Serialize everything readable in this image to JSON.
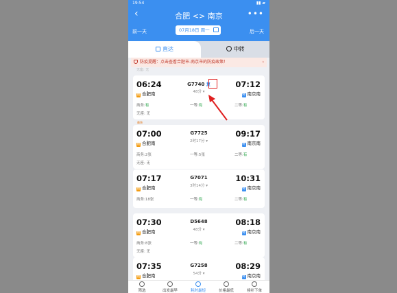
{
  "status_bar": {
    "time": "19:54",
    "icons": "▮▮ ▰"
  },
  "header": {
    "back": "‹",
    "title": "合肥 <> 南京",
    "more": "•••",
    "prev_day": "前一天",
    "next_day": "后一天",
    "date": "07月18日 周一"
  },
  "tabs": {
    "direct": "直达",
    "transfer": "中转"
  },
  "notice": {
    "text": "防疫提醒：点击查看合肥市-南京市的防疫政策！",
    "arrow": "›"
  },
  "cutoff_text": "无座: 无",
  "trains": [
    {
      "dep_time": "06:24",
      "arr_time": "07:12",
      "train_no": "G7740",
      "tag_icon": "复",
      "duration": "48分",
      "dep_station": "合肥南",
      "arr_station": "南京南",
      "dep_badge": "始",
      "arr_badge": "终",
      "seats": [
        {
          "label": "商务:",
          "value": "有"
        },
        {
          "label": "一等:",
          "value": "有"
        },
        {
          "label": "二等:",
          "value": "有"
        }
      ],
      "noseat": "无座: 无",
      "tag": ""
    },
    {
      "dep_time": "07:00",
      "arr_time": "09:17",
      "train_no": "G7725",
      "duration": "2时17分",
      "dep_station": "合肥南",
      "arr_station": "南京南",
      "dep_badge": "始",
      "arr_badge": "终",
      "seats": [
        {
          "label": "商务:",
          "value": "2张"
        },
        {
          "label": "一等:",
          "value": "5张"
        },
        {
          "label": "二等:",
          "value": "有"
        }
      ],
      "noseat": "无座: 无",
      "tag": "最快"
    },
    {
      "dep_time": "07:17",
      "arr_time": "10:31",
      "train_no": "G7071",
      "duration": "3时14分",
      "dep_station": "合肥南",
      "arr_station": "南京南",
      "dep_badge": "始",
      "arr_badge": "终",
      "seats": [
        {
          "label": "商务:",
          "value": "18张"
        },
        {
          "label": "一等:",
          "value": "有"
        },
        {
          "label": "二等:",
          "value": "有"
        }
      ],
      "noseat": "",
      "tag": ""
    },
    {
      "dep_time": "07:30",
      "arr_time": "08:18",
      "train_no": "D5648",
      "duration": "48分",
      "dep_station": "合肥南",
      "arr_station": "南京南",
      "dep_badge": "始",
      "arr_badge": "终",
      "seats": [
        {
          "label": "商务:",
          "value": "8张"
        },
        {
          "label": "一等:",
          "value": "有"
        },
        {
          "label": "二等:",
          "value": "有"
        }
      ],
      "noseat": "无座: 无",
      "tag": ""
    },
    {
      "dep_time": "07:35",
      "arr_time": "08:29",
      "train_no": "G7258",
      "duration": "54分",
      "dep_station": "合肥南",
      "arr_station": "南京南",
      "dep_badge": "始",
      "arr_badge": "终",
      "seats": [],
      "noseat": "",
      "tag": ""
    }
  ],
  "bottom_tabs": [
    "筛选",
    "出发最早",
    "耗时最短",
    "价格最低",
    "候补下单"
  ],
  "colors": {
    "brand": "#3b8ff0",
    "available": "#2aa54a",
    "highlight": "#e02020"
  }
}
